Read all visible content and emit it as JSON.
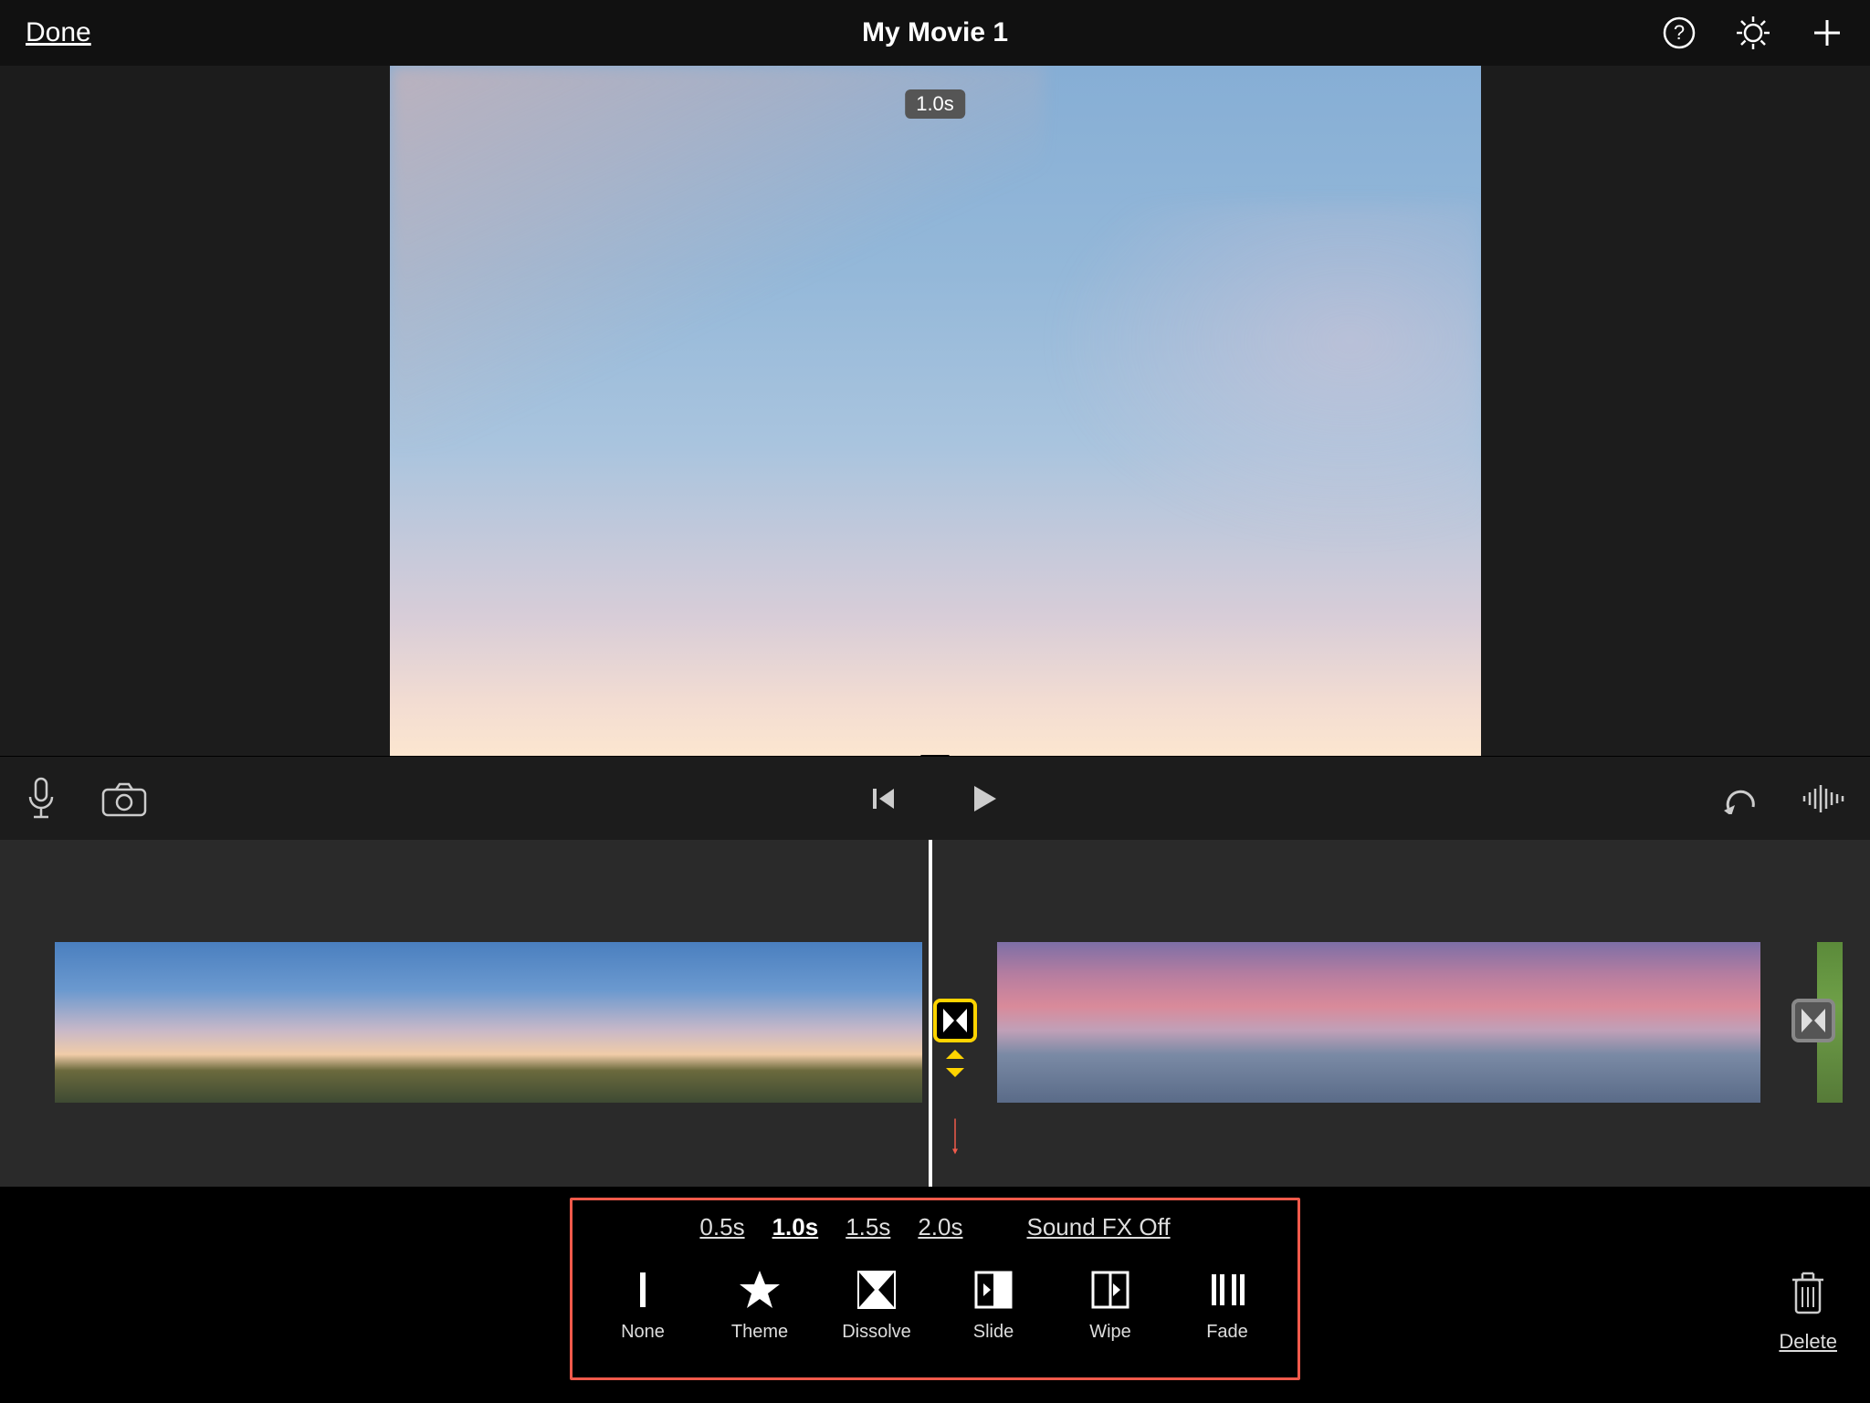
{
  "header": {
    "done_label": "Done",
    "title": "My Movie 1"
  },
  "preview": {
    "duration_badge": "1.0s"
  },
  "transitions": {
    "durations": [
      "0.5s",
      "1.0s",
      "1.5s",
      "2.0s"
    ],
    "selected_duration": "1.0s",
    "sound_fx_label": "Sound FX Off",
    "types": [
      {
        "id": "none",
        "label": "None"
      },
      {
        "id": "theme",
        "label": "Theme"
      },
      {
        "id": "dissolve",
        "label": "Dissolve"
      },
      {
        "id": "slide",
        "label": "Slide"
      },
      {
        "id": "wipe",
        "label": "Wipe"
      },
      {
        "id": "fade",
        "label": "Fade"
      }
    ],
    "selected_type": "dissolve"
  },
  "footer": {
    "delete_label": "Delete"
  }
}
